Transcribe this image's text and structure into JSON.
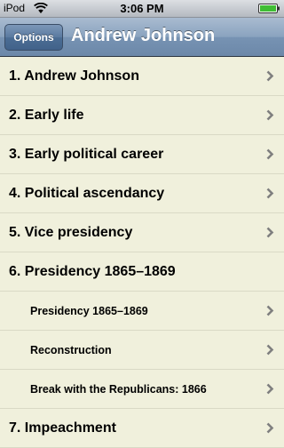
{
  "status_bar": {
    "carrier": "iPod",
    "time": "3:06 PM"
  },
  "nav": {
    "options_label": "Options",
    "title": "Andrew Johnson"
  },
  "toc": {
    "items": [
      {
        "label": "1. Andrew Johnson",
        "level": 1,
        "chevron": true
      },
      {
        "label": "2. Early life",
        "level": 1,
        "chevron": true
      },
      {
        "label": "3. Early political career",
        "level": 1,
        "chevron": true
      },
      {
        "label": "4. Political ascendancy",
        "level": 1,
        "chevron": true
      },
      {
        "label": "5. Vice presidency",
        "level": 1,
        "chevron": true
      },
      {
        "label": "6. Presidency 1865–1869",
        "level": 1,
        "chevron": false
      },
      {
        "label": "Presidency 1865–1869",
        "level": 2,
        "chevron": true
      },
      {
        "label": "Reconstruction",
        "level": 2,
        "chevron": true
      },
      {
        "label": "Break with the Republicans: 1866",
        "level": 2,
        "chevron": true
      },
      {
        "label": "7. Impeachment",
        "level": 1,
        "chevron": true
      }
    ]
  },
  "colors": {
    "list_background": "#f0f0dc",
    "separator": "#d9d9c5",
    "chevron": "#7f7f7f",
    "nav_bar": "#7793b3"
  },
  "icons": {
    "wifi": "wifi-icon",
    "battery": "battery-icon",
    "disclosure": "chevron-right-icon"
  }
}
